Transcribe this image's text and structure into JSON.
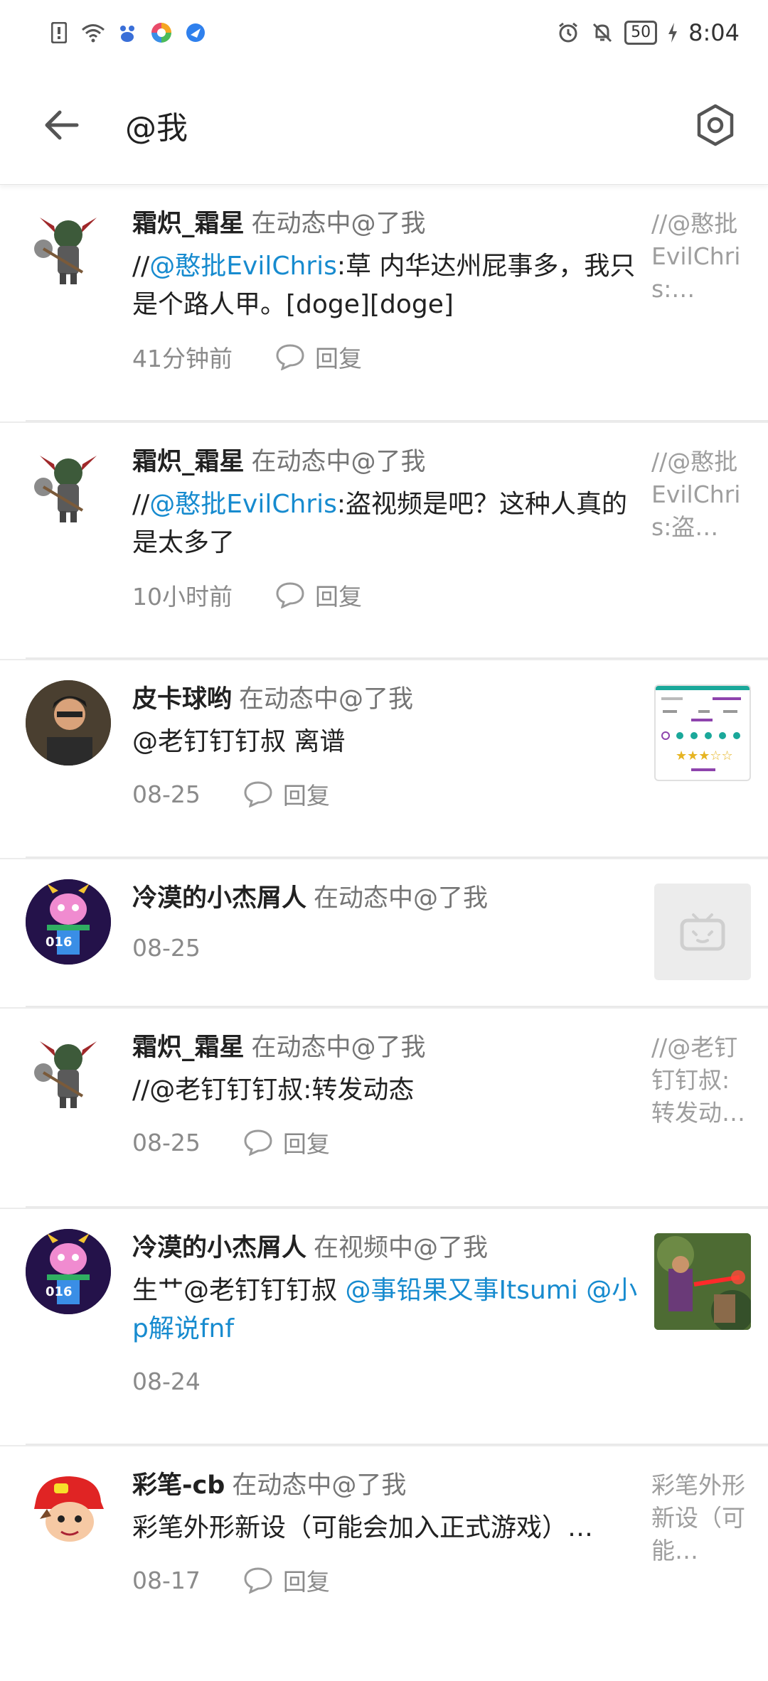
{
  "status_bar": {
    "time": "8:04",
    "battery": "50",
    "icons": [
      "alert-icon",
      "wifi-icon",
      "baidu-icon",
      "app-icon",
      "browser-icon",
      "alarm-icon",
      "mute-icon",
      "charging-icon"
    ]
  },
  "header": {
    "title": "@我",
    "back_icon": "arrow-left-icon",
    "settings_icon": "hexagon-settings-icon"
  },
  "reply_label": "回复",
  "items": [
    {
      "user": "霜炽_霜星",
      "action": "在动态中@了我",
      "text_parts": [
        "//",
        "@憨批EvilChris",
        ":草 内华达州屁事多，我只是个路人甲。[doge][doge]"
      ],
      "time": "41分钟前",
      "has_reply": true,
      "preview": "//@憨批EvilChris:…"
    },
    {
      "user": "霜炽_霜星",
      "action": "在动态中@了我",
      "text_parts": [
        "//",
        "@憨批EvilChris",
        ":盗视频是吧？这种人真的是太多了"
      ],
      "time": "10小时前",
      "has_reply": true,
      "preview": "//@憨批EvilChris:盗…"
    },
    {
      "user": "皮卡球哟",
      "action": "在动态中@了我",
      "text_parts": [
        "@老钉钉钉叔 离谱"
      ],
      "time": "08-25",
      "has_reply": true,
      "preview_type": "screenshot"
    },
    {
      "user": "冷漠的小杰屑人",
      "action": "在动态中@了我",
      "time": "08-25",
      "has_reply": false,
      "preview_type": "bilibili-placeholder"
    },
    {
      "user": "霜炽_霜星",
      "action": "在动态中@了我",
      "text_parts": [
        "//@老钉钉钉叔:转发动态"
      ],
      "time": "08-25",
      "has_reply": true,
      "preview": "//@老钉钉钉叔:转发动…"
    },
    {
      "user": "冷漠的小杰屑人",
      "action": "在视频中@了我",
      "text_parts": [
        "生艹@老钉钉钉叔 ",
        "@事铅果又事Itsumi @小p解说fnf"
      ],
      "time": "08-24",
      "has_reply": false,
      "preview_type": "video"
    },
    {
      "user": "彩笔-cb",
      "action": "在动态中@了我",
      "text_parts": [
        "彩笔外形新设（可能会加入正式游戏）…"
      ],
      "time": "08-17",
      "has_reply": true,
      "preview": "彩笔外形新设（可能…"
    }
  ]
}
